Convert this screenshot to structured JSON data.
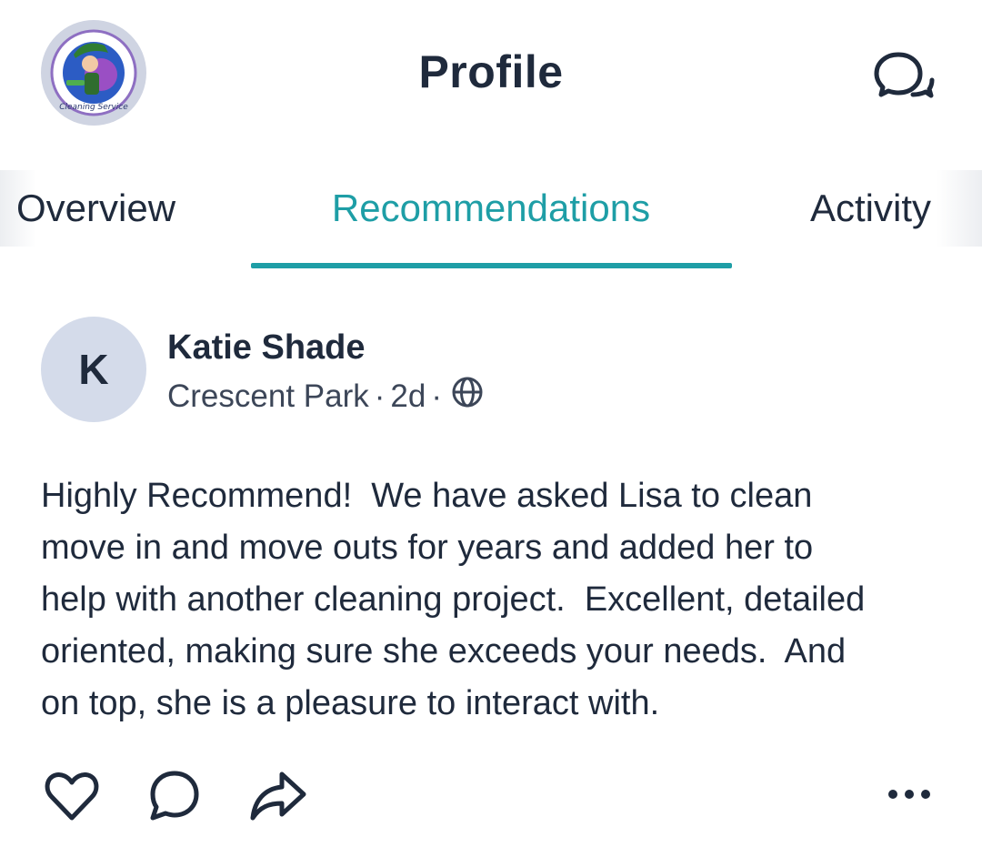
{
  "header": {
    "title": "Profile",
    "logo_text": "Lisa Cleaning Service",
    "chat_icon": "chat-bubbles-icon"
  },
  "tabs": [
    {
      "label": "Overview",
      "active": false
    },
    {
      "label": "Recommendations",
      "active": true
    },
    {
      "label": "Activity",
      "active": false
    }
  ],
  "post": {
    "avatar_initial": "K",
    "author": "Katie Shade",
    "location": "Crescent Park",
    "sep": "·",
    "age": "2d",
    "visibility_icon": "globe-icon",
    "body": "Highly Recommend!  We have asked Lisa to clean\nmove in and move outs for years and added her to\nhelp with another cleaning project.  Excellent, detailed\noriented, making sure she exceeds your needs.  And\non top, she is a pleasure to interact with.",
    "actions": [
      "heart-icon",
      "comment-icon",
      "share-icon",
      "more-icon"
    ]
  },
  "colors": {
    "accent": "#1e9ea6",
    "text": "#1f2a3c",
    "avatar_bg": "#d4dbea"
  }
}
